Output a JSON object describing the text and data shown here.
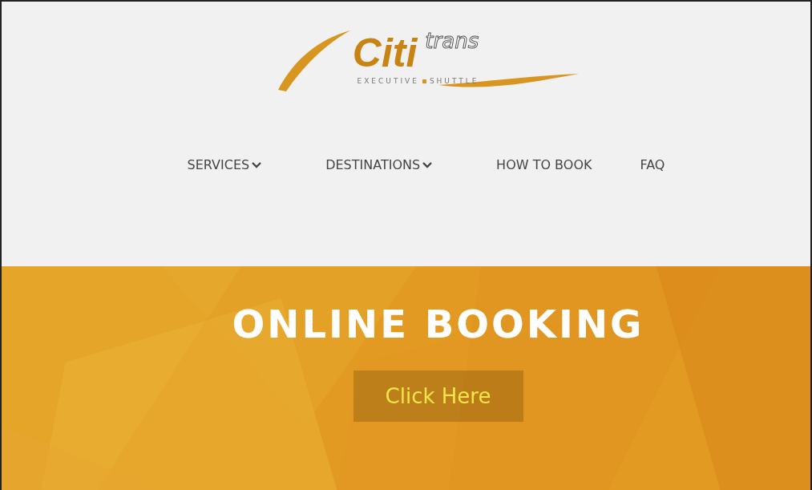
{
  "logo": {
    "brand": "Citi",
    "suffix": "trans",
    "tagline": [
      "EXECUTIVE",
      "SHUTTLE"
    ]
  },
  "nav": [
    {
      "label": "SERVICES",
      "has_dropdown": true
    },
    {
      "label": "DESTINATIONS",
      "has_dropdown": true
    },
    {
      "label": "HOW TO BOOK",
      "has_dropdown": false
    },
    {
      "label": "FAQ",
      "has_dropdown": false
    }
  ],
  "hero": {
    "title": "ONLINE BOOKING",
    "button": "Click Here"
  }
}
